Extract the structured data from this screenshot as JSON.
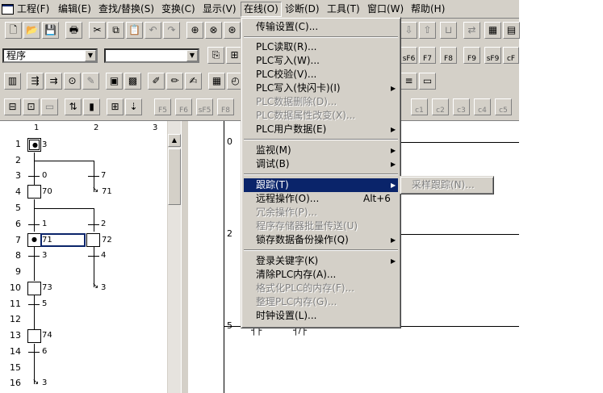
{
  "menubar": {
    "items": [
      "工程(F)",
      "编辑(E)",
      "查找/替换(S)",
      "变换(C)",
      "显示(V)",
      "在线(O)",
      "诊断(D)",
      "工具(T)",
      "窗口(W)",
      "帮助(H)"
    ],
    "active": "在线(O)"
  },
  "toolbar": {
    "program_combo": "程序",
    "second_combo": "",
    "func_keys": [
      "sF6",
      "F7",
      "F8",
      "F9",
      "sF9",
      "cF"
    ],
    "row3_keys": [
      "F5",
      "F6",
      "sF5",
      "F8"
    ],
    "row3_right_keys": [
      "c1",
      "c2",
      "c3",
      "c4",
      "c5"
    ]
  },
  "sfc": {
    "columns": [
      "1",
      "2",
      "3"
    ],
    "rows": [
      "1",
      "2",
      "3",
      "4",
      "5",
      "6",
      "7",
      "8",
      "9",
      "10",
      "11",
      "12",
      "13",
      "14",
      "15",
      "16"
    ],
    "labels": {
      "r1": "3",
      "r3a": "0",
      "r3b": "7",
      "r4a": "70",
      "r4b": "71",
      "r6a": "1",
      "r6b": "2",
      "r7a": "71",
      "r7b": "72",
      "r8a": "3",
      "r8b": "4",
      "r10a": "73",
      "r10b": "3",
      "r11": "5",
      "r13": "74",
      "r14": "6",
      "r16": "3"
    }
  },
  "ladder": {
    "rows": [
      "0",
      "2",
      "5"
    ]
  },
  "online_menu": {
    "items": [
      {
        "label": "传输设置(C)...",
        "shortcut": "",
        "sub": false,
        "disabled": false
      },
      {
        "label": "PLC读取(R)...",
        "shortcut": "",
        "sub": false,
        "disabled": false
      },
      {
        "label": "PLC写入(W)...",
        "shortcut": "",
        "sub": false,
        "disabled": false
      },
      {
        "label": "PLC校验(V)...",
        "shortcut": "",
        "sub": false,
        "disabled": false
      },
      {
        "label": "PLC写入(快闪卡)(I)",
        "shortcut": "",
        "sub": true,
        "disabled": false
      },
      {
        "label": "PLC数据删除(D)...",
        "shortcut": "",
        "sub": false,
        "disabled": true
      },
      {
        "label": "PLC数据属性改变(X)...",
        "shortcut": "",
        "sub": false,
        "disabled": true
      },
      {
        "label": "PLC用户数据(E)",
        "shortcut": "",
        "sub": true,
        "disabled": false
      },
      {
        "label": "监视(M)",
        "shortcut": "",
        "sub": true,
        "disabled": false
      },
      {
        "label": "调试(B)",
        "shortcut": "",
        "sub": true,
        "disabled": false
      },
      {
        "label": "跟踪(T)",
        "shortcut": "",
        "sub": true,
        "disabled": false,
        "highlight": true
      },
      {
        "label": "远程操作(O)...",
        "shortcut": "Alt+6",
        "sub": false,
        "disabled": false
      },
      {
        "label": "冗余操作(P)...",
        "shortcut": "",
        "sub": false,
        "disabled": true
      },
      {
        "label": "程序存储器批量传送(U)",
        "shortcut": "",
        "sub": false,
        "disabled": true
      },
      {
        "label": "锁存数据备份操作(Q)",
        "shortcut": "",
        "sub": true,
        "disabled": false
      },
      {
        "label": "登录关键字(K)",
        "shortcut": "",
        "sub": true,
        "disabled": false
      },
      {
        "label": "清除PLC内存(A)...",
        "shortcut": "",
        "sub": false,
        "disabled": false
      },
      {
        "label": "格式化PLC的内存(F)...",
        "shortcut": "",
        "sub": false,
        "disabled": true
      },
      {
        "label": "整理PLC内存(G)...",
        "shortcut": "",
        "sub": false,
        "disabled": true
      },
      {
        "label": "时钟设置(L)...",
        "shortcut": "",
        "sub": false,
        "disabled": false
      }
    ]
  },
  "trace_submenu": {
    "item": "采样跟踪(N)..."
  }
}
